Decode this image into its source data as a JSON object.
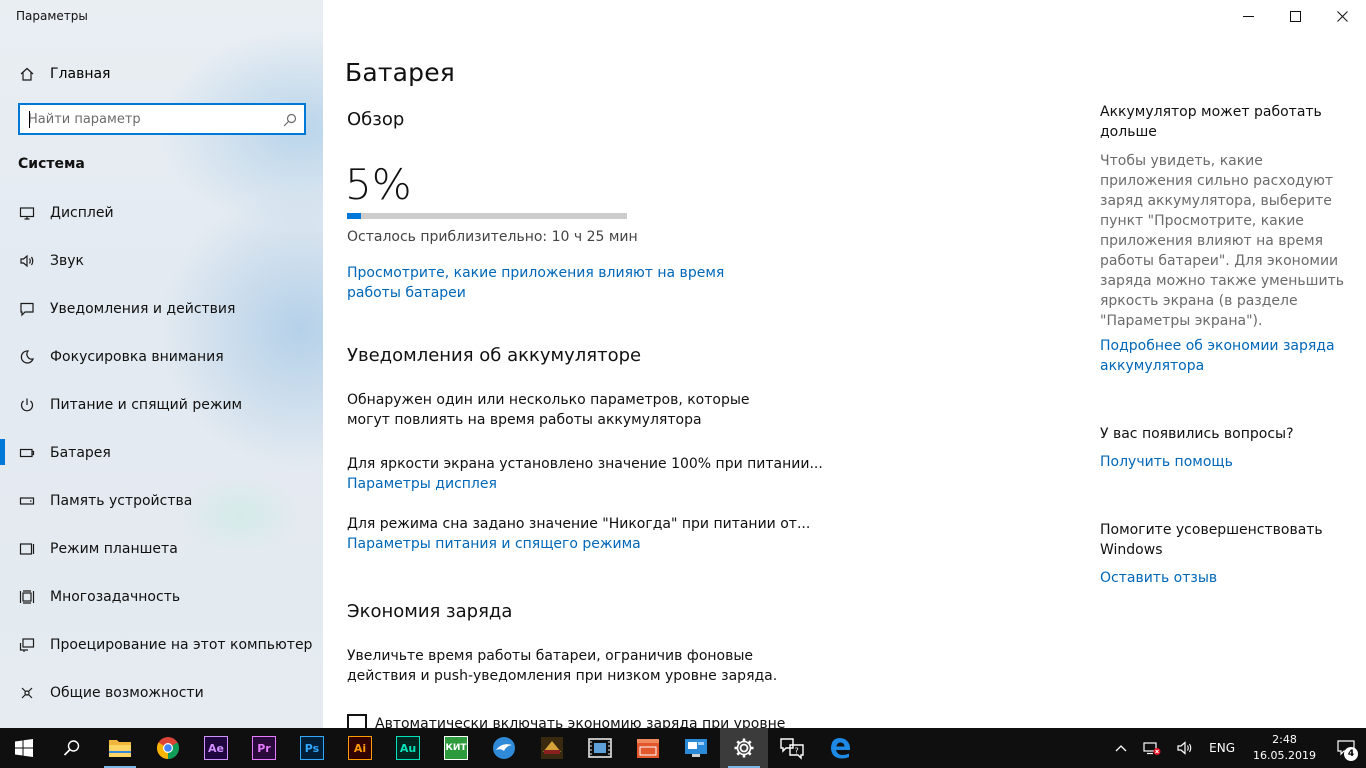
{
  "window": {
    "title": "Параметры"
  },
  "sidebar": {
    "home_label": "Главная",
    "search_placeholder": "Найти параметр",
    "section_label": "Система",
    "items": [
      {
        "label": "Дисплей",
        "icon": "monitor-icon"
      },
      {
        "label": "Звук",
        "icon": "speaker-icon"
      },
      {
        "label": "Уведомления и действия",
        "icon": "message-icon"
      },
      {
        "label": "Фокусировка внимания",
        "icon": "moon-icon"
      },
      {
        "label": "Питание и спящий режим",
        "icon": "power-icon"
      },
      {
        "label": "Батарея",
        "icon": "battery-icon",
        "active": true
      },
      {
        "label": "Память устройства",
        "icon": "storage-icon"
      },
      {
        "label": "Режим планшета",
        "icon": "tablet-icon"
      },
      {
        "label": "Многозадачность",
        "icon": "multitask-icon"
      },
      {
        "label": "Проецирование на этот компьютер",
        "icon": "project-icon"
      },
      {
        "label": "Общие возможности",
        "icon": "shared-icon"
      }
    ]
  },
  "main": {
    "title": "Батарея",
    "overview": {
      "heading": "Обзор",
      "percent_text": "5%",
      "percent_value": 0.05,
      "remaining": "Осталось приблизительно: 10 ч 25 мин",
      "apps_link": "Просмотрите, какие приложения влияют на время работы батареи"
    },
    "notifications": {
      "heading": "Уведомления об аккумуляторе",
      "intro": "Обнаружен один или несколько параметров, которые могут повлиять на время работы аккумулятора",
      "brightness_text": "Для яркости экрана установлено значение 100% при питании...",
      "display_link": "Параметры дисплея",
      "sleep_text": "Для режима сна задано значение \"Никогда\" при питании от...",
      "power_link": "Параметры питания и спящего режима"
    },
    "saver": {
      "heading": "Экономия заряда",
      "description": "Увеличьте время работы батареи, ограничив фоновые действия и push-уведомления при низком уровне заряда.",
      "checkbox_label": "Автоматически включать экономию заряда при уровне"
    }
  },
  "right": {
    "tip_title": "Аккумулятор может работать дольше",
    "tip_body": "Чтобы увидеть, какие приложения сильно расходуют заряд аккумулятора, выберите пункт \"Просмотрите, какие приложения влияют на время работы батареи\". Для экономии заряда можно также уменьшить яркость экрана (в разделе \"Параметры экрана\").",
    "tip_link": "Подробнее об экономии заряда аккумулятора",
    "questions_title": "У вас появились вопросы?",
    "help_link": "Получить помощь",
    "improve_title": "Помогите усовершенствовать Windows",
    "feedback_link": "Оставить отзыв"
  },
  "taskbar": {
    "apps": [
      {
        "name": "start",
        "label": ""
      },
      {
        "name": "search",
        "label": ""
      },
      {
        "name": "file-explorer",
        "label": "",
        "running": true
      },
      {
        "name": "chrome",
        "label": ""
      },
      {
        "name": "after-effects",
        "label": "Ae",
        "color": "#d291ff",
        "bg": "#1f0740"
      },
      {
        "name": "premiere",
        "label": "Pr",
        "color": "#e579ff",
        "bg": "#2a0a3a"
      },
      {
        "name": "photoshop",
        "label": "Ps",
        "color": "#31a8ff",
        "bg": "#001e36"
      },
      {
        "name": "illustrator",
        "label": "Ai",
        "color": "#ff9a00",
        "bg": "#330000"
      },
      {
        "name": "audition",
        "label": "Au",
        "color": "#00e4bb",
        "bg": "#00271f"
      },
      {
        "name": "kit",
        "label": "КИТ",
        "color": "#ffffff",
        "bg": "#2e9a3e"
      },
      {
        "name": "dolphin",
        "label": ""
      },
      {
        "name": "game",
        "label": ""
      },
      {
        "name": "video-editor",
        "label": ""
      },
      {
        "name": "film-tool",
        "label": ""
      },
      {
        "name": "remote-app",
        "label": ""
      },
      {
        "name": "settings",
        "label": "",
        "active": true
      },
      {
        "name": "feedback-hub",
        "label": ""
      },
      {
        "name": "edge",
        "label": ""
      }
    ],
    "language": "ENG",
    "time": "2:48",
    "date": "16.05.2019",
    "notification_count": "4"
  }
}
